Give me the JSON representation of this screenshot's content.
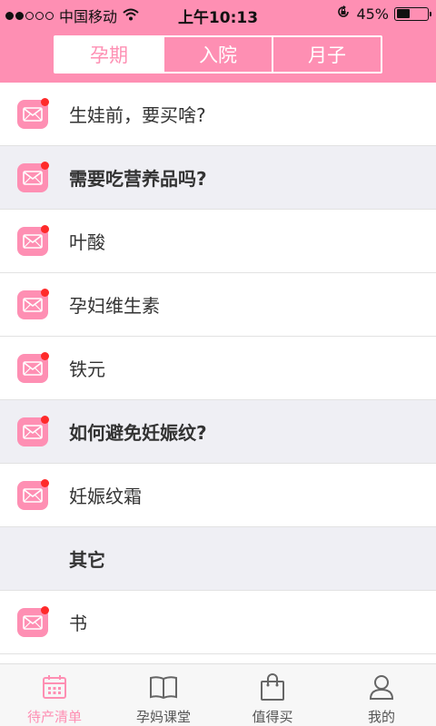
{
  "status_bar": {
    "carrier": "中国移动",
    "time": "上午10:13",
    "battery": "45%",
    "battery_level": 0.45,
    "signal_dots": 5,
    "signal_filled": 2
  },
  "tabs": [
    {
      "label": "孕期",
      "active": true
    },
    {
      "label": "入院",
      "active": false
    },
    {
      "label": "月子",
      "active": false
    }
  ],
  "list": [
    {
      "label": "生娃前，要买啥?",
      "type": "item",
      "icon": "mail-icon",
      "badge": true
    },
    {
      "label": "需要吃营养品吗?",
      "type": "section",
      "icon": "mail-icon",
      "badge": true
    },
    {
      "label": "叶酸",
      "type": "item",
      "icon": "mail-icon",
      "badge": true
    },
    {
      "label": "孕妇维生素",
      "type": "item",
      "icon": "mail-icon",
      "badge": true
    },
    {
      "label": "铁元",
      "type": "item",
      "icon": "mail-icon",
      "badge": true
    },
    {
      "label": "如何避免妊娠纹?",
      "type": "section",
      "icon": "mail-icon",
      "badge": true
    },
    {
      "label": "妊娠纹霜",
      "type": "item",
      "icon": "mail-icon",
      "badge": true
    },
    {
      "label": "其它",
      "type": "section",
      "icon": "",
      "badge": false
    },
    {
      "label": "书",
      "type": "item",
      "icon": "mail-icon",
      "badge": true
    }
  ],
  "tabbar": [
    {
      "label": "待产清单",
      "icon": "calendar-icon",
      "active": true
    },
    {
      "label": "孕妈课堂",
      "icon": "book-icon",
      "active": false
    },
    {
      "label": "值得买",
      "icon": "shopping-bag-icon",
      "active": false
    },
    {
      "label": "我的",
      "icon": "person-icon",
      "active": false
    }
  ],
  "colors": {
    "accent": "#fe8fb3",
    "badge": "#ff2a2a",
    "section_bg": "#efeff4"
  }
}
